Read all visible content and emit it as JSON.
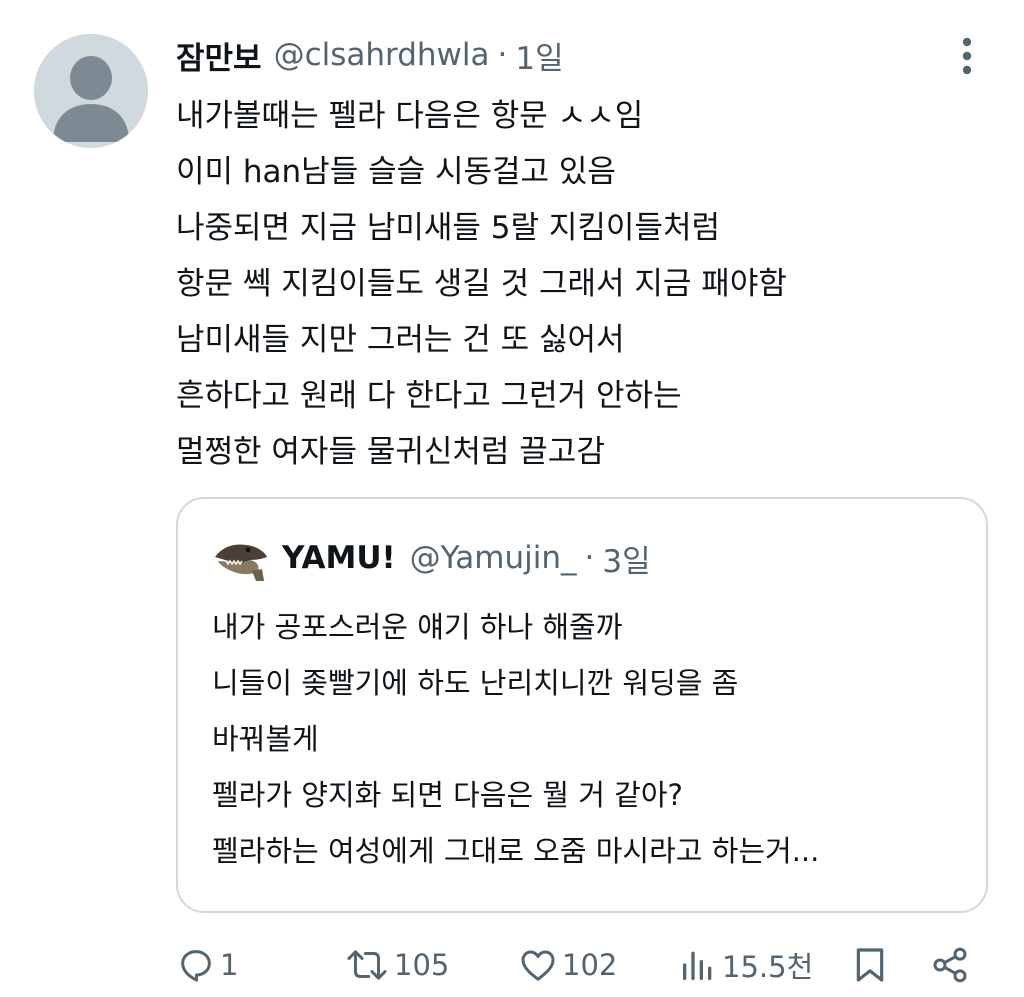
{
  "tweet": {
    "author_name": "잠만보",
    "handle": "@clsahrdhwla",
    "separator": "·",
    "time": "1일",
    "text_lines": [
      "내가볼때는 펠라 다음은 항문 ㅅㅅ임",
      "이미 han남들 슬슬 시동걸고 있음",
      "나중되면 지금 남미새들 5랄 지킴이들처럼",
      "항문 쎅 지킴이들도 생길 것 그래서 지금 패야함",
      "남미새들 지만 그러는 건 또 싫어서",
      "흔하다고 원래 다 한다고 그런거 안하는",
      "멀쩡한 여자들 물귀신처럼 끌고감"
    ]
  },
  "quoted_tweet": {
    "author_name": "YAMU!",
    "handle": "@Yamujin_",
    "separator": "·",
    "time": "3일",
    "text_lines": [
      "내가 공포스러운 얘기 하나 해줄까",
      "니들이 좆빨기에 하도 난리치니깐 워딩을 좀",
      "바꿔볼게",
      "펠라가 양지화 되면 다음은 뭘 거 같아?",
      "펠라하는 여성에게 그대로 오줌 마시라고 하는거..."
    ]
  },
  "actions": {
    "reply": {
      "icon": "reply-icon",
      "count": "1"
    },
    "retweet": {
      "icon": "retweet-icon",
      "count": "105"
    },
    "like": {
      "icon": "heart-icon",
      "count": "102"
    },
    "views": {
      "icon": "views-icon",
      "count": "15.5천"
    },
    "bookmark": {
      "icon": "bookmark-icon"
    },
    "share": {
      "icon": "share-icon"
    }
  },
  "colors": {
    "text": "#0f1419",
    "secondary": "#536471",
    "border": "#cfd9de",
    "avatar_bg": "#cfd9de",
    "avatar_fg": "#7d8a94"
  }
}
